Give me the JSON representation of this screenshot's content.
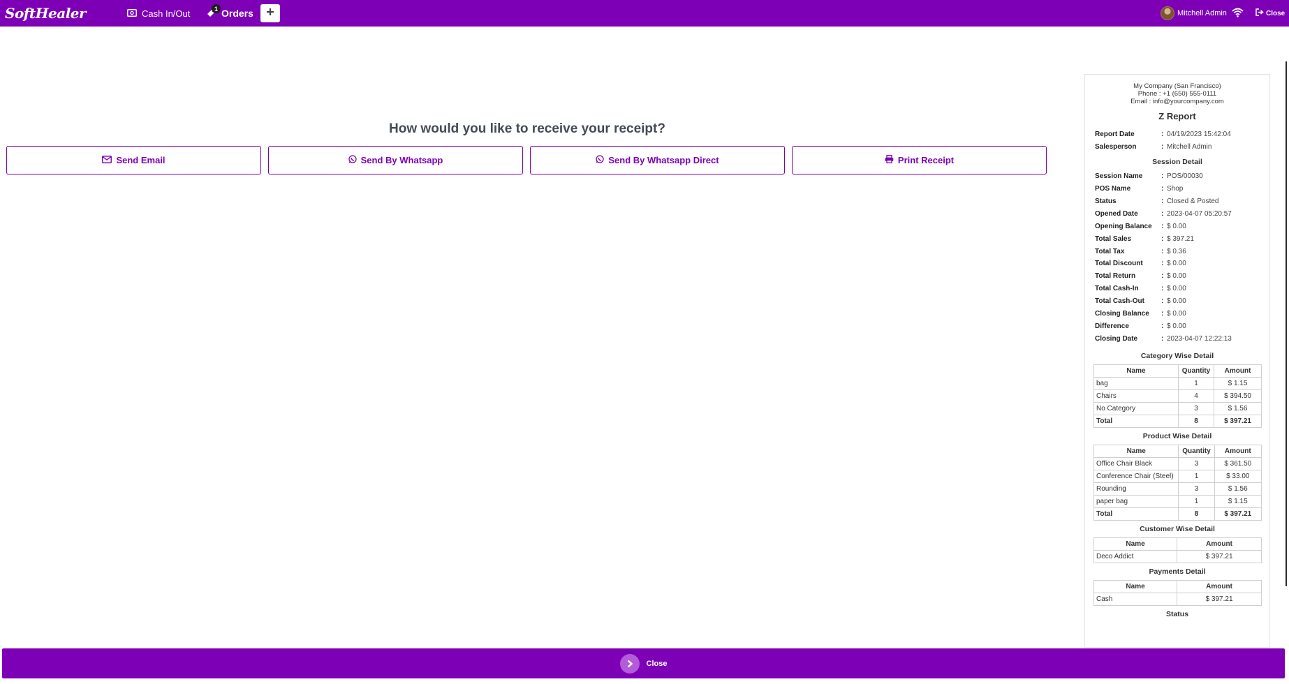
{
  "topbar": {
    "logo": "SoftHealer",
    "cash_label": "Cash In/Out",
    "orders_label": "Orders",
    "orders_badge": "1",
    "add_label": "+",
    "user_name": "Mitchell Admin",
    "close_label": "Close",
    "accent_color": "#7d00b6"
  },
  "receipt": {
    "question": "How would you like to receive your receipt?",
    "buttons": [
      {
        "label": "Send Email",
        "icon": "envelope-icon"
      },
      {
        "label": "Send By Whatsapp",
        "icon": "whatsapp-icon"
      },
      {
        "label": "Send By Whatsapp Direct",
        "icon": "whatsapp-icon"
      },
      {
        "label": "Print Receipt",
        "icon": "printer-icon"
      }
    ]
  },
  "report": {
    "company_lines": [
      "My Company (San Francisco)",
      "Phone : +1 (650) 555-0111",
      "Email : info@yourcompany.com"
    ],
    "title": "Z Report",
    "header_fields": [
      {
        "k": "Report Date",
        "v": "04/19/2023 15:42:04"
      },
      {
        "k": "Salesperson",
        "v": "Mitchell Admin"
      }
    ],
    "session_title": "Session Detail",
    "session_fields": [
      {
        "k": "Session Name",
        "v": "POS/00030"
      },
      {
        "k": "POS Name",
        "v": "Shop"
      },
      {
        "k": "Status",
        "v": "Closed & Posted"
      },
      {
        "k": "Opened Date",
        "v": "2023-04-07 05:20:57"
      },
      {
        "k": "Opening Balance",
        "v": "$ 0.00"
      },
      {
        "k": "Total Sales",
        "v": "$ 397.21"
      },
      {
        "k": "Total Tax",
        "v": "$ 0.36"
      },
      {
        "k": "Total Discount",
        "v": "$ 0.00"
      },
      {
        "k": "Total Return",
        "v": "$ 0.00"
      },
      {
        "k": "Total Cash-In",
        "v": "$ 0.00"
      },
      {
        "k": "Total Cash-Out",
        "v": "$ 0.00"
      },
      {
        "k": "Closing Balance",
        "v": "$ 0.00"
      },
      {
        "k": "Difference",
        "v": "$ 0.00"
      },
      {
        "k": "Closing Date",
        "v": "2023-04-07 12:22:13"
      }
    ],
    "category": {
      "title": "Category Wise Detail",
      "headers": [
        "Name",
        "Quantity",
        "Amount"
      ],
      "rows": [
        [
          "bag",
          "1",
          "$ 1.15"
        ],
        [
          "Chairs",
          "4",
          "$ 394.50"
        ],
        [
          "No Category",
          "3",
          "$ 1.56"
        ]
      ],
      "total": [
        "Total",
        "8",
        "$ 397.21"
      ]
    },
    "product": {
      "title": "Product Wise Detail",
      "headers": [
        "Name",
        "Quantity",
        "Amount"
      ],
      "rows": [
        [
          "Office Chair Black",
          "3",
          "$ 361.50"
        ],
        [
          "Conference Chair (Steel)",
          "1",
          "$ 33.00"
        ],
        [
          "Rounding",
          "3",
          "$ 1.56"
        ],
        [
          "paper bag",
          "1",
          "$ 1.15"
        ]
      ],
      "total": [
        "Total",
        "8",
        "$ 397.21"
      ]
    },
    "customer": {
      "title": "Customer Wise Detail",
      "headers": [
        "Name",
        "Amount"
      ],
      "rows": [
        [
          "Deco Addict",
          "$ 397.21"
        ]
      ]
    },
    "payments": {
      "title": "Payments Detail",
      "headers": [
        "Name",
        "Amount"
      ],
      "rows": [
        [
          "Cash",
          "$ 397.21"
        ]
      ]
    },
    "status_title": "Status"
  },
  "bottom": {
    "close_label": "Close"
  }
}
